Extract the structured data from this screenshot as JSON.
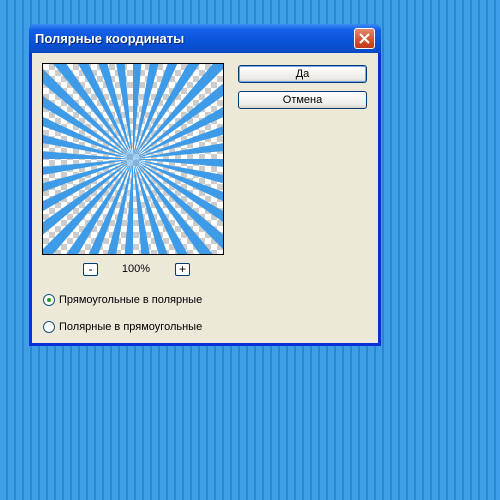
{
  "window": {
    "title": "Полярные координаты",
    "close_icon": "close-icon"
  },
  "preview": {
    "zoom_level": "100%",
    "zoom_out_label": "-",
    "zoom_in_label": "+",
    "ray_color": "#3d9be8"
  },
  "buttons": {
    "ok_label": "Да",
    "cancel_label": "Отмена"
  },
  "options": {
    "rect_to_polar": {
      "label": "Прямоугольные в полярные",
      "selected": true
    },
    "polar_to_rect": {
      "label": "Полярные в прямоугольные",
      "selected": false
    }
  },
  "colors": {
    "titlebar": "#0a53d8",
    "dialog_bg": "#ece9d8",
    "desktop_stripe": "#3e9ee6"
  }
}
